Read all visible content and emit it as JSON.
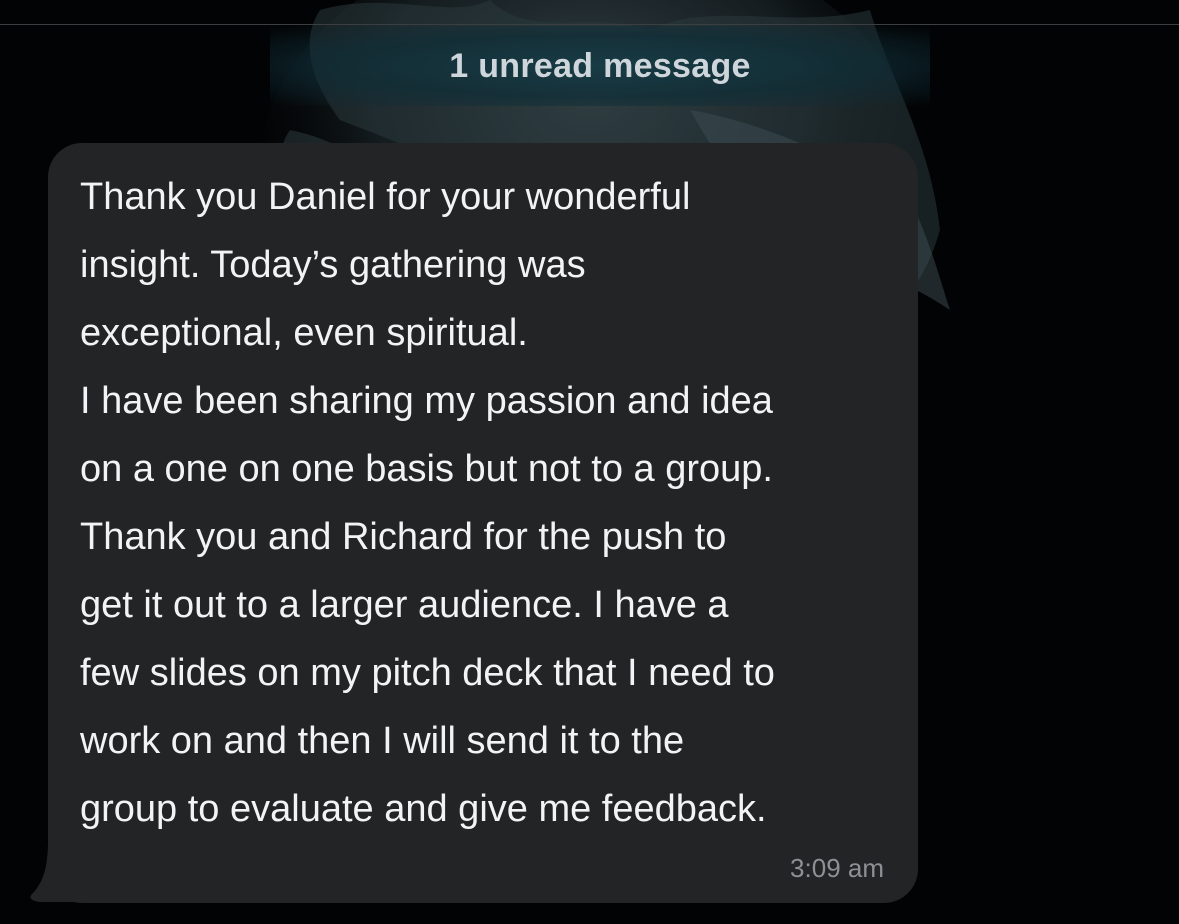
{
  "chat": {
    "unread_label": "1 unread message",
    "message": {
      "lines": [
        "Thank you Daniel for your wonderful",
        "insight. Today’s gathering was",
        "exceptional, even spiritual.",
        "I have been sharing my passion and idea",
        "on a one on one basis but not to a group.",
        "Thank you and Richard for the push to",
        "get it out to a larger audience. I have a",
        "few slides on my pitch deck that I need to",
        "work on and then I will send it to the",
        "group to evaluate and give me feedback."
      ],
      "time": "3:09 am"
    }
  },
  "colors": {
    "background": "#020304",
    "bubble": "#222426",
    "message_text": "#f2f3f4",
    "timestamp_text": "#8d9196",
    "unread_bar": "#12404a"
  },
  "icons": {
    "wallpaper": "dark-fish-wallpaper"
  }
}
